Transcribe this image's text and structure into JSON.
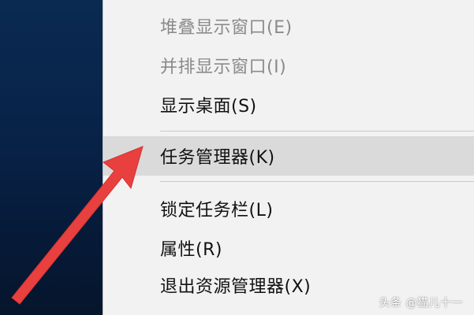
{
  "context_menu": {
    "items": [
      {
        "label": "堆叠显示窗口(E)",
        "state": "disabled"
      },
      {
        "label": "并排显示窗口(I)",
        "state": "disabled"
      },
      {
        "label": "显示桌面(S)",
        "state": "enabled"
      },
      {
        "label": "任务管理器(K)",
        "state": "highlighted"
      },
      {
        "label": "锁定任务栏(L)",
        "state": "enabled"
      },
      {
        "label": "属性(R)",
        "state": "enabled"
      },
      {
        "label": "退出资源管理器(X)",
        "state": "enabled"
      }
    ]
  },
  "annotation": {
    "arrow_color": "#e8403f",
    "arrow_icon": "red-pointer-arrow"
  },
  "watermark": {
    "text": "头条 @猫儿十一"
  },
  "colors": {
    "desktop": "#082247",
    "menu_background": "#f2f2f2",
    "highlight": "#dadada",
    "disabled_text": "#8a8a8a"
  }
}
